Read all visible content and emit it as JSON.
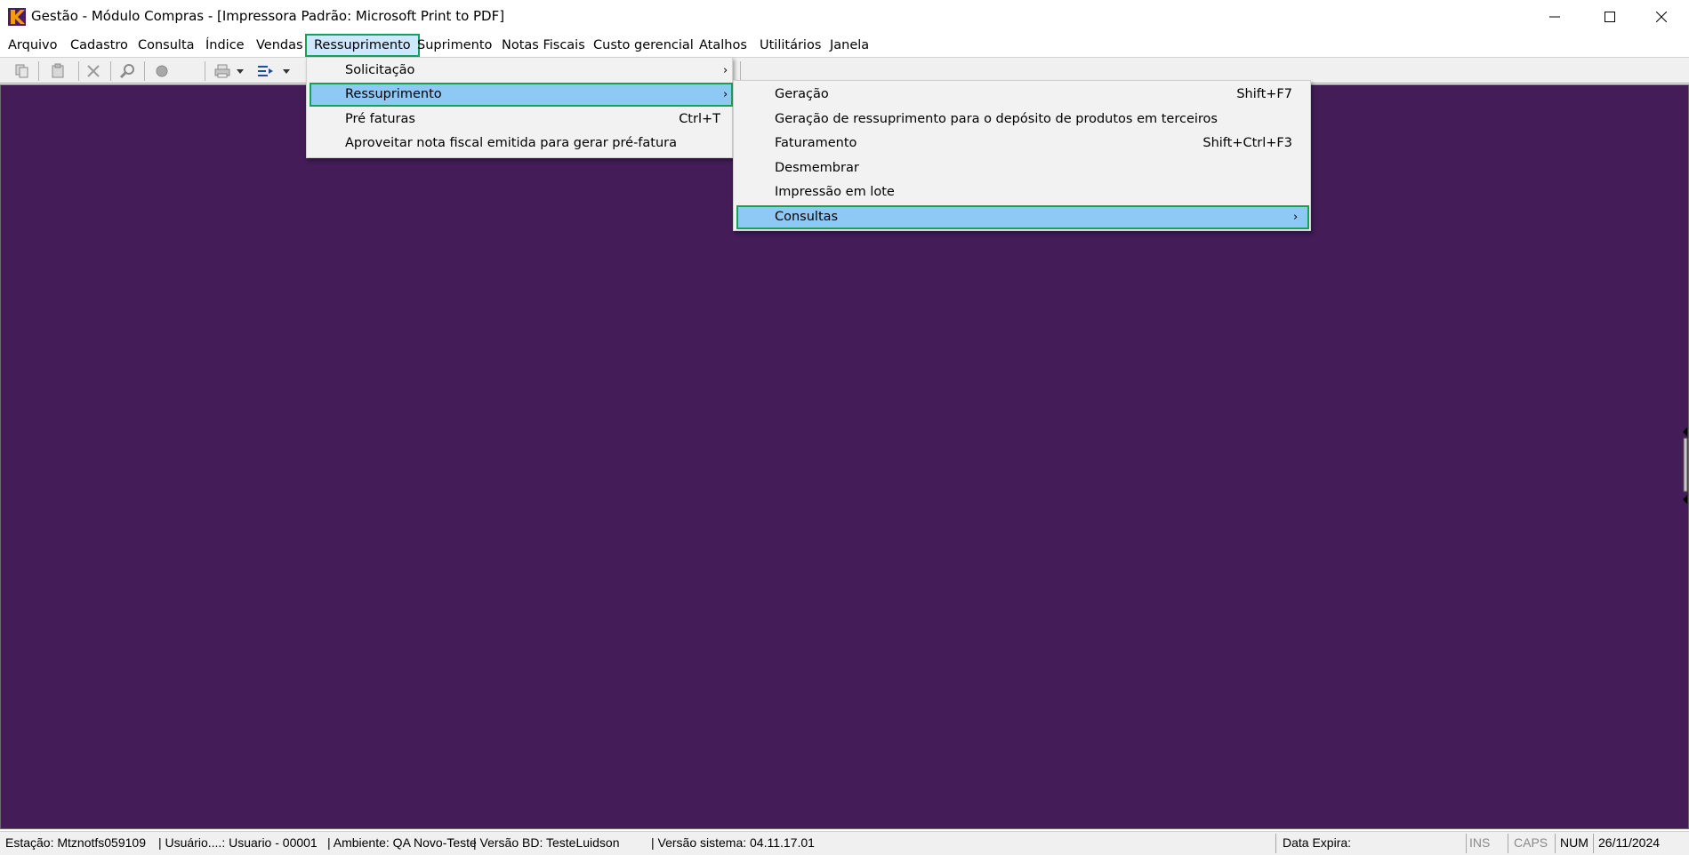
{
  "window": {
    "title": "Gestão  - Módulo Compras - [Impressora Padrão: Microsoft Print to PDF]",
    "minimize_glyph": "—",
    "maximize_glyph": "☐",
    "close_glyph": "✕"
  },
  "menubar": {
    "items": [
      "Arquivo",
      "Cadastro",
      "Consulta",
      "Índice",
      "Vendas",
      "Ressuprimento",
      "Suprimento",
      "Notas Fiscais",
      "Custo gerencial",
      "Atalhos",
      "Utilitários",
      "Janela"
    ],
    "active_index": 5
  },
  "dropdown_primary": {
    "items": [
      {
        "label": "Solicitação",
        "shortcut": "",
        "submenu": true
      },
      {
        "label": "Ressuprimento",
        "shortcut": "",
        "submenu": true
      },
      {
        "label": "Pré faturas",
        "shortcut": "Ctrl+T",
        "submenu": false
      },
      {
        "label": "Aproveitar nota fiscal emitida para gerar pré-fatura",
        "shortcut": "",
        "submenu": false
      }
    ],
    "highlighted_index": 1
  },
  "dropdown_secondary": {
    "items": [
      {
        "label": "Geração",
        "shortcut": "Shift+F7",
        "submenu": false
      },
      {
        "label": "Geração de ressuprimento para o depósito de produtos em terceiros",
        "shortcut": "",
        "submenu": false
      },
      {
        "label": "Faturamento",
        "shortcut": "Shift+Ctrl+F3",
        "submenu": false
      },
      {
        "label": "Desmembrar",
        "shortcut": "",
        "submenu": false
      },
      {
        "label": "Impressão em lote",
        "shortcut": "",
        "submenu": false
      },
      {
        "label": "Consultas",
        "shortcut": "",
        "submenu": true
      }
    ],
    "highlighted_index": 5
  },
  "submenu_arrow": "›",
  "statusbar": {
    "station": "Estação: Mtznotfs059109",
    "user": "| Usuário....: Usuario - 00001",
    "environment": "| Ambiente: QA Novo-Teste",
    "db_version": "| Versão BD: TesteLuidson",
    "system_version": "| Versão sistema: 04.11.17.01",
    "expiry": "Data Expira:",
    "ins": "INS",
    "caps": "CAPS",
    "num": "NUM",
    "date": "26/11/2024"
  },
  "colors": {
    "workspace": "#431c58",
    "highlight": "#8ec8f5",
    "highlight_border": "#16a05d"
  }
}
